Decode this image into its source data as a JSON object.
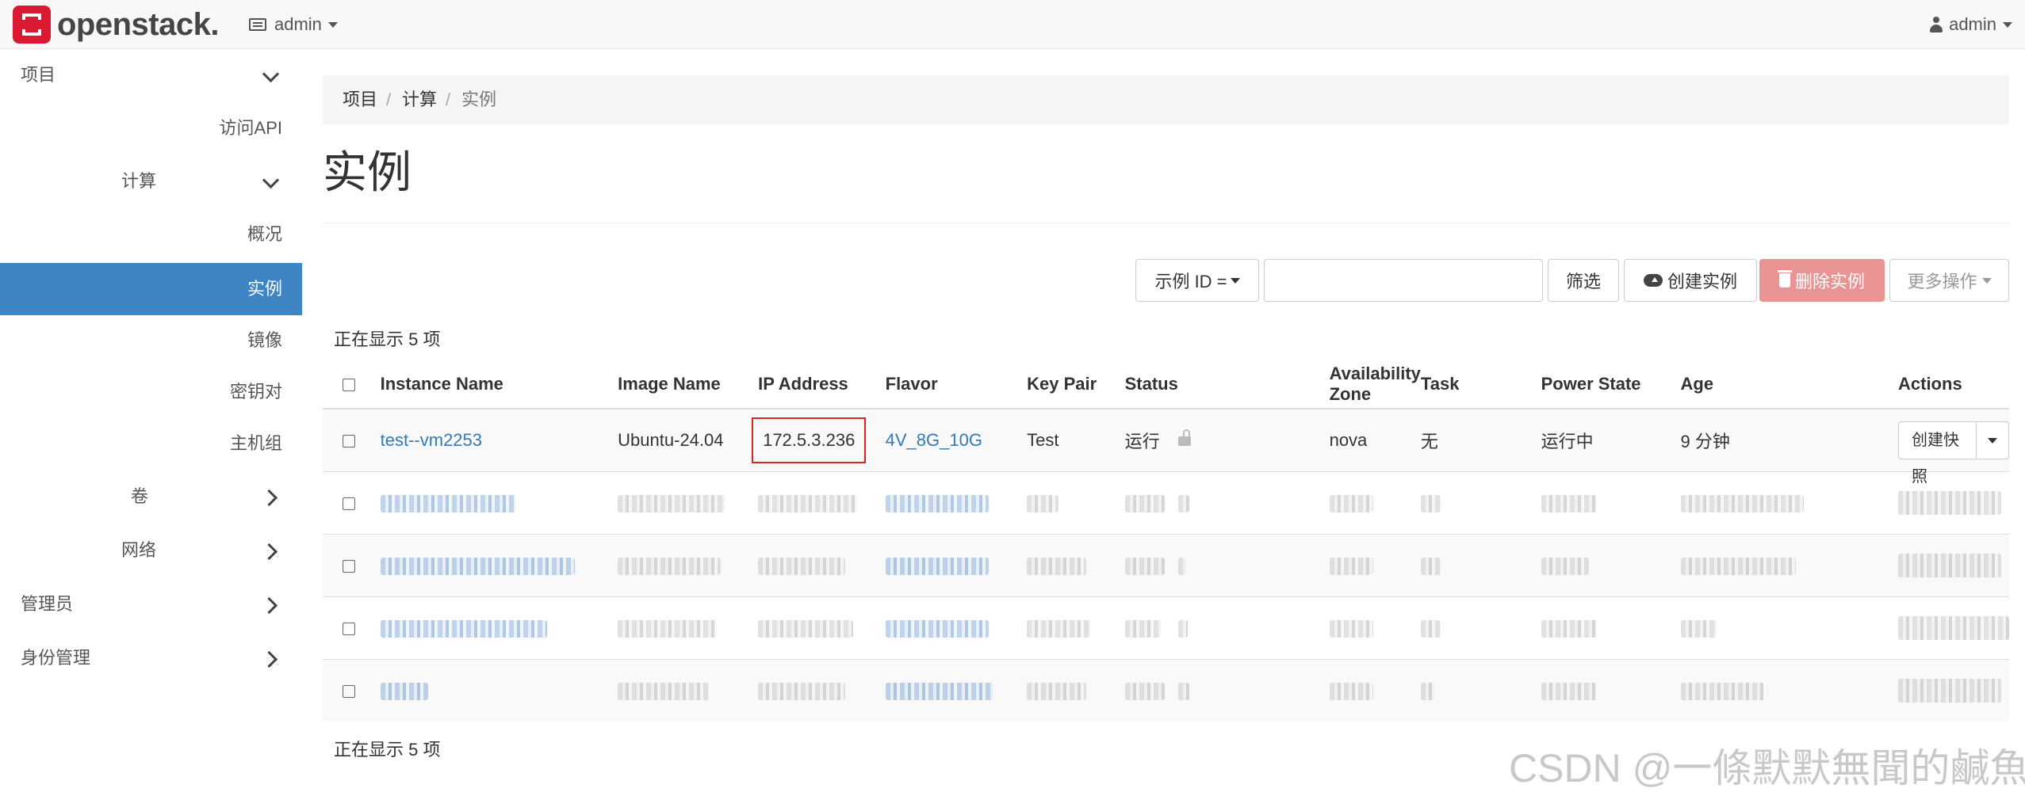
{
  "app": {
    "logo_text": "openstack."
  },
  "navbar": {
    "project_label": "admin",
    "user_label": "admin"
  },
  "sidebar": {
    "project": "项目",
    "api_access": "访问API",
    "compute": "计算",
    "overview": "概况",
    "instances": "实例",
    "images": "镜像",
    "key_pairs": "密钥对",
    "host_aggregates": "主机组",
    "volumes": "卷",
    "network": "网络",
    "admin": "管理员",
    "identity": "身份管理"
  },
  "breadcrumb": [
    "项目",
    "计算",
    "实例"
  ],
  "page_title": "实例",
  "toolbar": {
    "filter_field": "示例 ID =",
    "filter_value": "",
    "filter_button": "筛选",
    "create_button": "创建实例",
    "delete_button": "删除实例",
    "more_actions": "更多操作"
  },
  "count_text": "正在显示 5 项",
  "table": {
    "columns": [
      "Instance Name",
      "Image Name",
      "IP Address",
      "Flavor",
      "Key Pair",
      "Status",
      "Availability Zone",
      "Task",
      "Power State",
      "Age",
      "Actions"
    ],
    "rows": [
      {
        "name": "test--vm2253",
        "image": "Ubuntu-24.04",
        "ip": "172.5.3.236",
        "flavor": "4V_8G_10G",
        "key_pair": "Test",
        "status": "运行",
        "zone": "nova",
        "task": "无",
        "power_state": "运行中",
        "age": "9 分钟",
        "action": "创建快照"
      }
    ]
  },
  "watermark": "CSDN @一條默默無聞的鹹魚",
  "colors": {
    "accent": "#3f85c4",
    "link": "#337ab7",
    "danger": "#e99494",
    "highlight_box": "#d9261c"
  }
}
